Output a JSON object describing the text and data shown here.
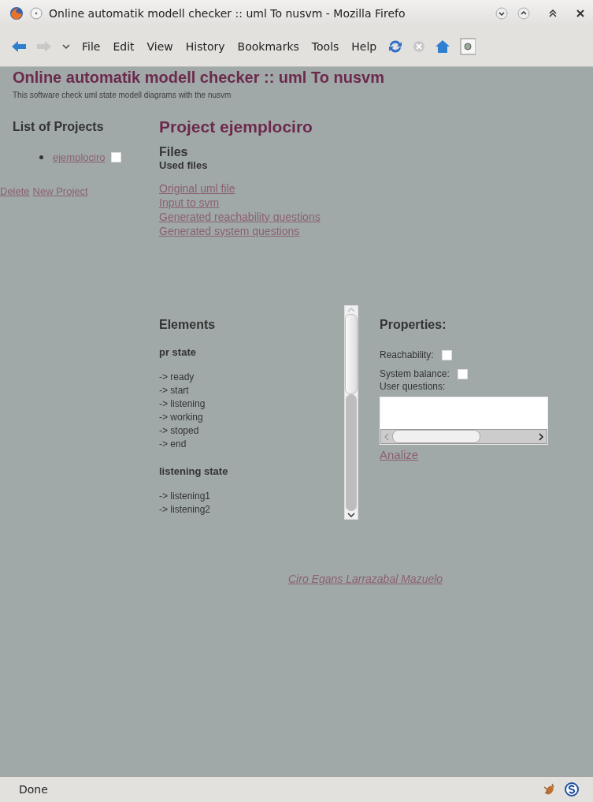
{
  "window": {
    "title": "Online automatik modell checker :: uml To nusvm - Mozilla Firefo"
  },
  "menu": [
    "File",
    "Edit",
    "View",
    "History",
    "Bookmarks",
    "Tools",
    "Help"
  ],
  "page": {
    "title": "Online automatik modell checker :: uml To nusvm",
    "subtitle": "This software check uml state modell diagrams with the nusvm"
  },
  "sidebar": {
    "heading": "List of Projects",
    "projects": [
      {
        "name": "ejemplociro",
        "checked": false
      }
    ],
    "actions": [
      "Delete",
      "New Project"
    ]
  },
  "project": {
    "title": "Project ejemplociro",
    "files_heading": "Files",
    "used_files": "Used files",
    "links": [
      "Original uml file",
      "Input to svm",
      "Generated reachability questions",
      "Generated system questions"
    ]
  },
  "elements": {
    "heading": "Elements",
    "groups": [
      {
        "title": "pr state",
        "items": [
          "-> ready",
          "-> start",
          "-> listening",
          "-> working",
          "-> stoped",
          "-> end"
        ]
      },
      {
        "title": "listening state",
        "items": [
          "-> listening1",
          "-> listening2"
        ]
      }
    ]
  },
  "properties": {
    "heading": "Properties:",
    "checks": [
      {
        "label": "Reachability:",
        "checked": false
      },
      {
        "label": "System balance:",
        "checked": false
      }
    ],
    "questions_label": "User questions:",
    "action": "Analize"
  },
  "footer": {
    "author": "Ciro Egans Larrazabal Mazuelo"
  },
  "status_bar": {
    "text": "Done"
  }
}
